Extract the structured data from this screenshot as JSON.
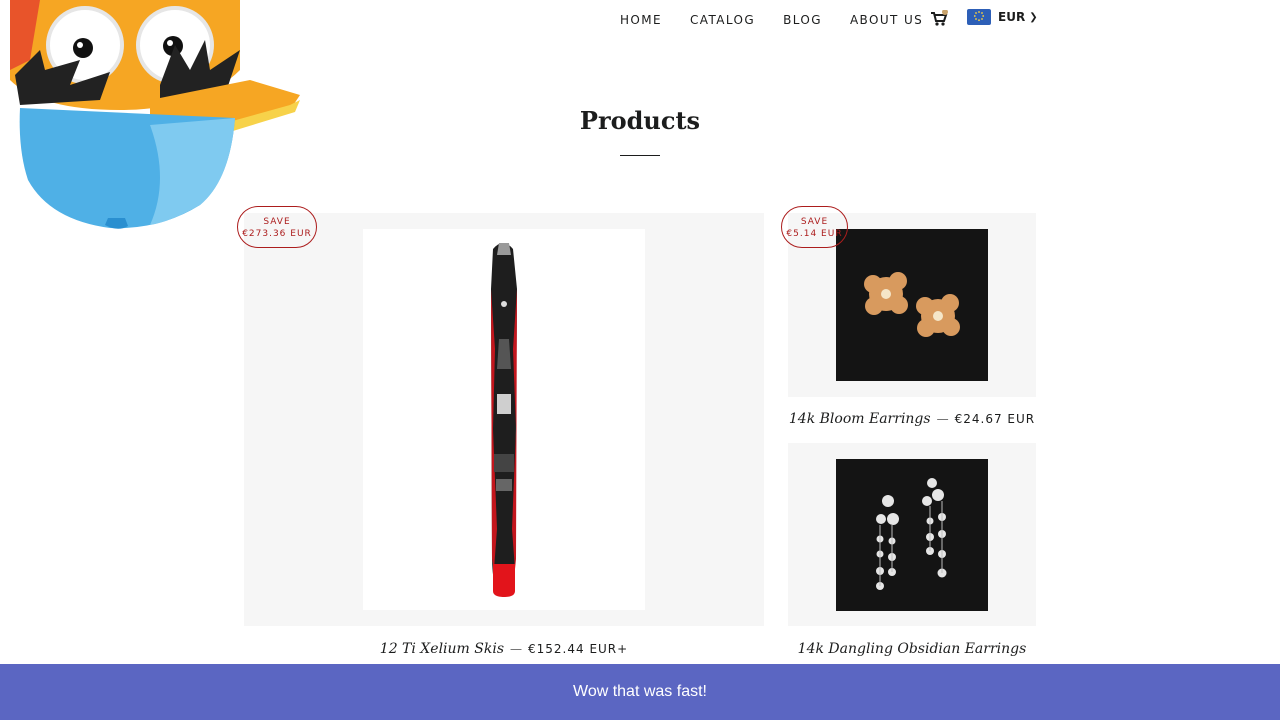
{
  "nav": {
    "items": [
      "HOME",
      "CATALOG",
      "BLOG",
      "ABOUT US"
    ],
    "cart_icon": "cart-icon",
    "currency": "EUR",
    "flag_icon": "eu-flag-icon"
  },
  "page": {
    "title": "Products"
  },
  "products": [
    {
      "name": "12 Ti Xelium Skis",
      "separator": "—",
      "price": "€152.44 EUR+",
      "badge_line1": "SAVE",
      "badge_line2": "€273.36 EUR",
      "image": "ski-image"
    },
    {
      "name": "14k Bloom Earrings",
      "separator": "—",
      "price": "€24.67 EUR",
      "badge_line1": "SAVE",
      "badge_line2": "€5.14 EUR",
      "image": "bloom-earrings-image"
    },
    {
      "name": "14k Dangling Obsidian Earrings",
      "image": "dangling-earrings-image"
    }
  ],
  "banner": {
    "text": "Wow that was fast!"
  },
  "colors": {
    "banner": "#5b66c2",
    "badge": "#ac1d1d",
    "card_bg": "#f6f6f6"
  }
}
